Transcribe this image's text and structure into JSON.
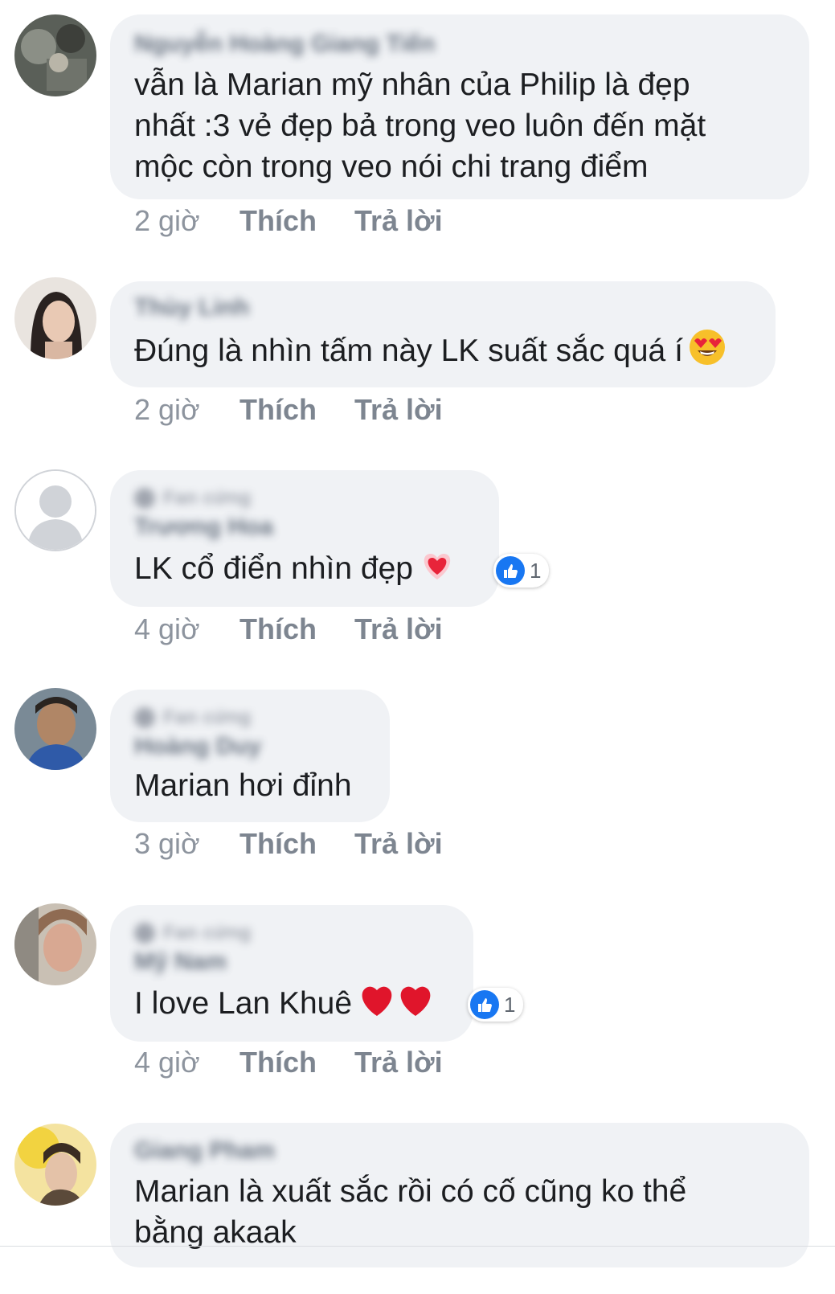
{
  "comments": [
    {
      "name": "Nguyễn Hoàng Giang Tiến",
      "fan_badge": "",
      "text_lines": [
        "vẫn là Marian mỹ nhân của Philip là đẹp",
        "nhất :3 vẻ đẹp bả trong veo luôn đến mặt",
        "mộc còn trong veo nói chi trang điểm"
      ],
      "time": "2 giờ",
      "like": "Thích",
      "reply": "Trả lời",
      "avatar_icon": "profile-photo-1"
    },
    {
      "name": "Thùy Linh",
      "fan_badge": "",
      "text": "Đúng là nhìn tấm này LK suất sắc quá í",
      "emoji": "heart-eyes-emoji",
      "time": "2 giờ",
      "like": "Thích",
      "reply": "Trả lời",
      "avatar_icon": "profile-photo-2"
    },
    {
      "name": "Trương Hoa",
      "fan_badge": "Fan cứng",
      "text": "LK cổ điển nhìn đẹp",
      "emoji": "sparkling-heart-emoji",
      "reaction_count": "1",
      "time": "4 giờ",
      "like": "Thích",
      "reply": "Trả lời",
      "avatar_icon": "default-avatar-icon"
    },
    {
      "name": "Hoàng Duy",
      "fan_badge": "Fan cứng",
      "text": "Marian hơi đỉnh",
      "time": "3 giờ",
      "like": "Thích",
      "reply": "Trả lời",
      "avatar_icon": "profile-photo-4"
    },
    {
      "name": "Mỹ Nam",
      "fan_badge": "Fan cứng",
      "text": "I love Lan Khuê",
      "emoji": "red-heart-emoji",
      "reaction_count": "1",
      "time": "4 giờ",
      "like": "Thích",
      "reply": "Trả lời",
      "avatar_icon": "profile-photo-5"
    },
    {
      "name": "Giang Pham",
      "fan_badge": "",
      "text_lines": [
        "Marian là xuất sắc rồi có cố cũng ko thể",
        "bằng akaak"
      ],
      "avatar_icon": "profile-photo-6"
    }
  ],
  "colors": {
    "bubble": "#f0f2f5",
    "text": "#1c1e21",
    "meta": "#8d949e",
    "like_blue": "#1877f2"
  }
}
